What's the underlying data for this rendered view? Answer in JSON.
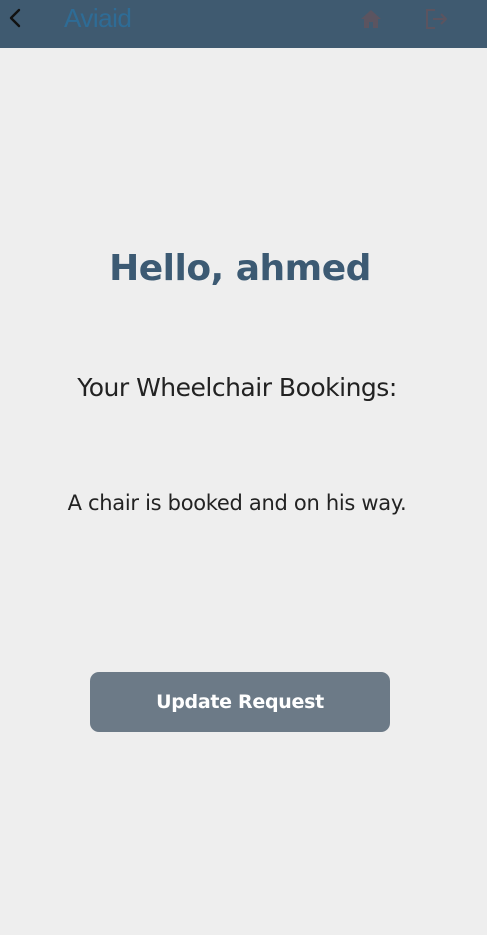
{
  "header": {
    "logo_text": "Aviaid",
    "back_icon": "chevron-left-icon",
    "home_icon": "home-icon",
    "logout_icon": "logout-icon",
    "colors": {
      "bar": "#3f5a70",
      "logo": "#2e6c96",
      "icons": "#5b5460"
    }
  },
  "main": {
    "greeting": "Hello, ahmed",
    "bookings_heading": "Your Wheelchair Bookings:",
    "booking_status": "A chair is booked and on his way.",
    "update_button_label": "Update Request"
  },
  "colors": {
    "background": "#eeeeee",
    "greeting": "#3c5a73",
    "button": "#6c7a87"
  }
}
